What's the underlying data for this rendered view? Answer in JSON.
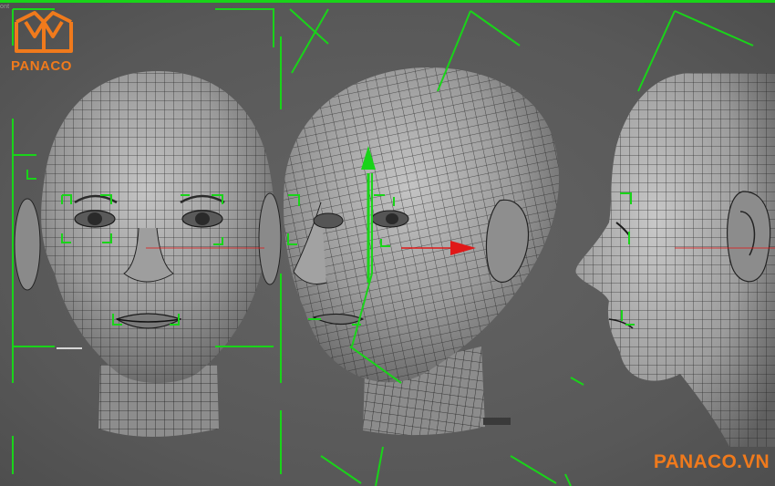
{
  "viewport": {
    "label": "ont",
    "colors": {
      "background": "#5a5a5a",
      "selection_bracket": "#19d419",
      "gizmo_y": "#19d419",
      "gizmo_x": "#e01818",
      "mesh_fill": "#8f8f8f",
      "mesh_wire": "#1f1f1f",
      "brand": "#f07a1c"
    }
  },
  "views": [
    {
      "name": "front",
      "object": "head-mesh"
    },
    {
      "name": "three-quarter",
      "object": "head-mesh"
    },
    {
      "name": "side",
      "object": "head-mesh"
    }
  ],
  "branding": {
    "logo_text": "PANACO",
    "watermark": "PANACO.VN",
    "logo_icon": "open-book-icon"
  }
}
